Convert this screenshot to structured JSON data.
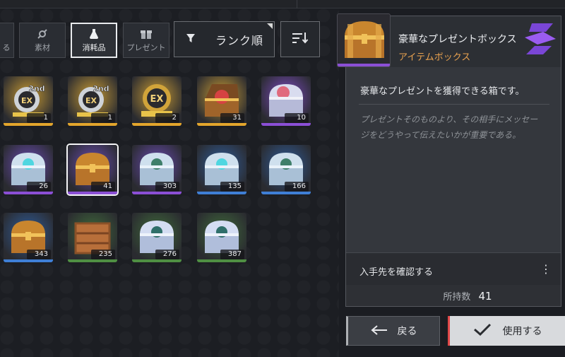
{
  "tabs": [
    {
      "label": "る",
      "icon": "partial-tab-icon"
    },
    {
      "label": "素材",
      "icon": "gear-tools-icon"
    },
    {
      "label": "消耗品",
      "icon": "flask-icon"
    },
    {
      "label": "プレゼント",
      "icon": "gift-box-icon"
    }
  ],
  "sort": {
    "label": "ランク順",
    "filter_icon": "funnel-icon",
    "order_icon": "sort-descending-icon"
  },
  "items": [
    {
      "count": "1",
      "art": "token-2nd-ex",
      "bg": "#c89b34",
      "quality": "#e3a52c"
    },
    {
      "count": "1",
      "art": "token-2nd-ex",
      "bg": "#c89b34",
      "quality": "#e3a52c"
    },
    {
      "count": "2",
      "art": "token-ex",
      "bg": "#c89b34",
      "quality": "#e3a52c"
    },
    {
      "count": "31",
      "art": "open-red-chest",
      "bg": "#c89b34",
      "quality": "#e3a52c"
    },
    {
      "count": "10",
      "art": "pink-silver-chest",
      "bg": "#7d4bc2",
      "quality": "#8b4fd6"
    },
    {
      "count": "26",
      "art": "silver-chest-cyan",
      "bg": "#6b4bb5",
      "quality": "#8b4fd6"
    },
    {
      "count": "41",
      "art": "gold-chest",
      "bg": "#6b4bb5",
      "quality": "#8b4fd6"
    },
    {
      "count": "303",
      "art": "silver-chest-green",
      "bg": "#6b4bb5",
      "quality": "#8b4fd6"
    },
    {
      "count": "135",
      "art": "silver-chest-cyan",
      "bg": "#2f5c9a",
      "quality": "#3f7fd6"
    },
    {
      "count": "166",
      "art": "silver-chest-green",
      "bg": "#2f5c9a",
      "quality": "#3f7fd6"
    },
    {
      "count": "343",
      "art": "gold-chest",
      "bg": "#2f5c9a",
      "quality": "#3f7fd6"
    },
    {
      "count": "235",
      "art": "wood-crate",
      "bg": "#3f6a3a",
      "quality": "#4f8f43"
    },
    {
      "count": "276",
      "art": "silver-chest-teal",
      "bg": "#3f6a3a",
      "quality": "#4f8f43"
    },
    {
      "count": "387",
      "art": "silver-chest-teal",
      "bg": "#3f6a3a",
      "quality": "#4f8f43"
    }
  ],
  "detail": {
    "name": "豪華なプレゼントボックス",
    "type": "アイテムボックス",
    "description": "豪華なプレゼントを獲得できる箱です。",
    "flavor": "プレゼントそのものより、その相手にメッセージをどうやって伝えたいかが重要である。",
    "acquire_label": "入手先を確認する",
    "more_icon": "⋮",
    "owned_label": "所持数",
    "owned_value": "41"
  },
  "buttons": {
    "back": "戻る",
    "use": "使用する"
  },
  "colors": {
    "accent_purple": "#8b4fd6",
    "accent_red": "#e04848",
    "type_orange": "#e9a24f"
  }
}
